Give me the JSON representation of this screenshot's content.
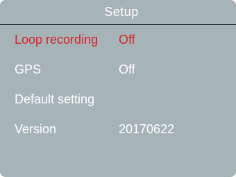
{
  "header": {
    "title": "Setup"
  },
  "menu": {
    "items": [
      {
        "label": "Loop recording",
        "value": "Off",
        "selected": true
      },
      {
        "label": "GPS",
        "value": "Off",
        "selected": false
      },
      {
        "label": "Default setting",
        "value": "",
        "selected": false
      },
      {
        "label": "Version",
        "value": "20170622",
        "selected": false
      }
    ]
  },
  "colors": {
    "background": "#a6b4b8",
    "text": "#ffffff",
    "selected_text": "#d8202a",
    "divider": "#1a1a1a"
  }
}
